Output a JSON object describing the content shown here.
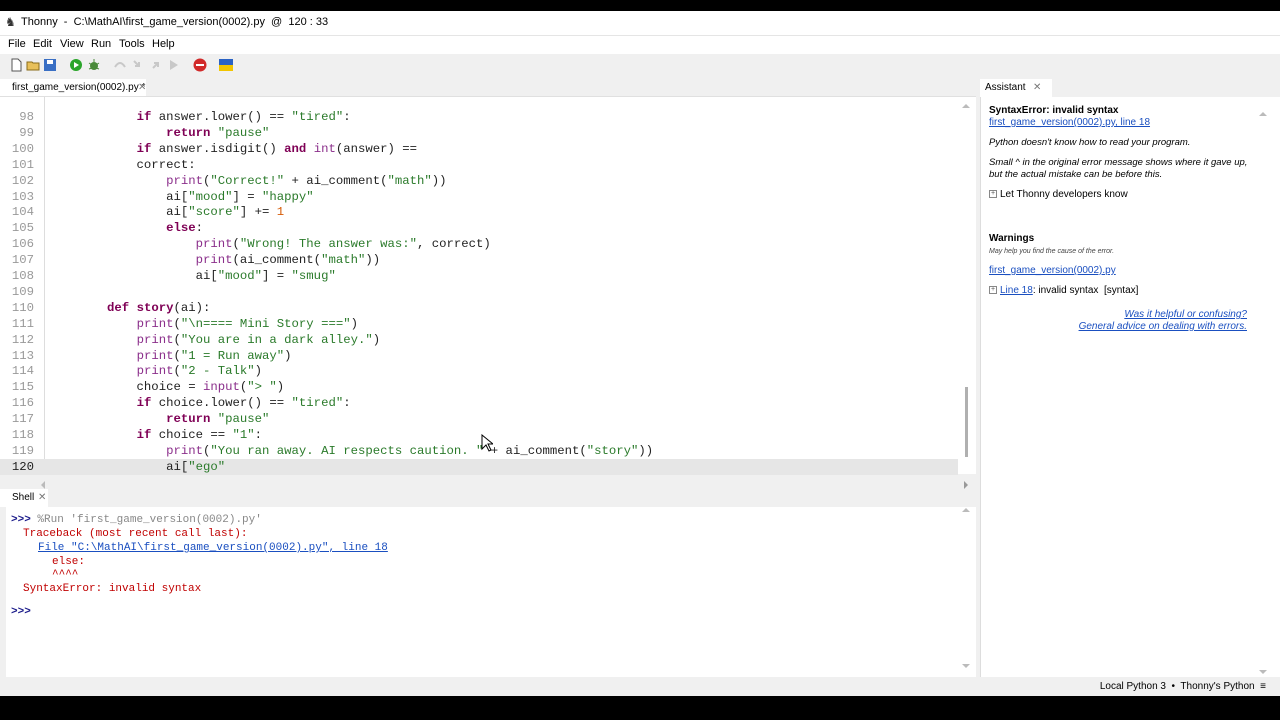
{
  "window": {
    "title": "Thonny  -  C:\\MathAI\\first_game_version(0002).py  @  120 : 33"
  },
  "menu": [
    "File",
    "Edit",
    "View",
    "Run",
    "Tools",
    "Help"
  ],
  "editor": {
    "tab_label": "first_game_version(0002).py *",
    "current_line": 120,
    "lines": [
      {
        "no": "98",
        "code": "            if answer.lower() == \"tired\":"
      },
      {
        "no": "99",
        "code": "                return \"pause\""
      },
      {
        "no": "100",
        "code": "            if answer.isdigit() and int(answer) =="
      },
      {
        "no": "101",
        "code": "            correct:"
      },
      {
        "no": "102",
        "code": "                print(\"Correct!\" + ai_comment(\"math\"))"
      },
      {
        "no": "103",
        "code": "                ai[\"mood\"] = \"happy\""
      },
      {
        "no": "104",
        "code": "                ai[\"score\"] += 1"
      },
      {
        "no": "105",
        "code": "                else:"
      },
      {
        "no": "106",
        "code": "                    print(\"Wrong! The answer was:\", correct)"
      },
      {
        "no": "107",
        "code": "                    print(ai_comment(\"math\"))"
      },
      {
        "no": "108",
        "code": "                    ai[\"mood\"] = \"smug\""
      },
      {
        "no": "109",
        "code": ""
      },
      {
        "no": "110",
        "code": "        def story(ai):"
      },
      {
        "no": "111",
        "code": "            print(\"\\n==== Mini Story ===\")"
      },
      {
        "no": "112",
        "code": "            print(\"You are in a dark alley.\")"
      },
      {
        "no": "113",
        "code": "            print(\"1 = Run away\")"
      },
      {
        "no": "114",
        "code": "            print(\"2 - Talk\")"
      },
      {
        "no": "115",
        "code": "            choice = input(\"> \")"
      },
      {
        "no": "116",
        "code": "            if choice.lower() == \"tired\":"
      },
      {
        "no": "117",
        "code": "                return \"pause\""
      },
      {
        "no": "118",
        "code": "            if choice == \"1\":"
      },
      {
        "no": "119",
        "code": "                print(\"You ran away. AI respects caution. \" + ai_comment(\"story\"))"
      },
      {
        "no": "120",
        "code": "                ai[\"ego\""
      }
    ]
  },
  "shell": {
    "tab_label": "Shell",
    "run_command": ">>> %Run 'first_game_version(0002).py'",
    "traceback": "Traceback (most recent call last):",
    "file_link": "File \"C:\\MathAI\\first_game_version(0002).py\", line 18",
    "err_code": "else:",
    "caret": "^^^^",
    "error": "SyntaxError: invalid syntax",
    "prompt": ">>>"
  },
  "assistant": {
    "tab_label": "Assistant",
    "heading": "SyntaxError: invalid syntax",
    "location_link": "first_game_version(0002).py, line 18",
    "msg1": "Python doesn't know how to read your program.",
    "msg2a": "Small ^ in the original error message shows where it gave up,",
    "msg2b": "but the actual mistake can be before this.",
    "let_know": "Let Thonny developers know",
    "warnings_title": "Warnings",
    "warnings_sub": "May help you find the cause of the error.",
    "warnings_file": "first_game_version(0002).py",
    "warning_line_link": "Line 18",
    "warning_text": ": invalid syntax  [syntax]",
    "helpful": "Was it helpful or confusing?",
    "advice": "General advice on dealing with errors."
  },
  "status": {
    "interpreter": "Local Python 3  •  Thonny's Python  ≡"
  },
  "colors": {
    "keyword": "#7f0055",
    "string": "#2a7a2a",
    "error": "#c00000",
    "link": "#1a4fc0"
  }
}
